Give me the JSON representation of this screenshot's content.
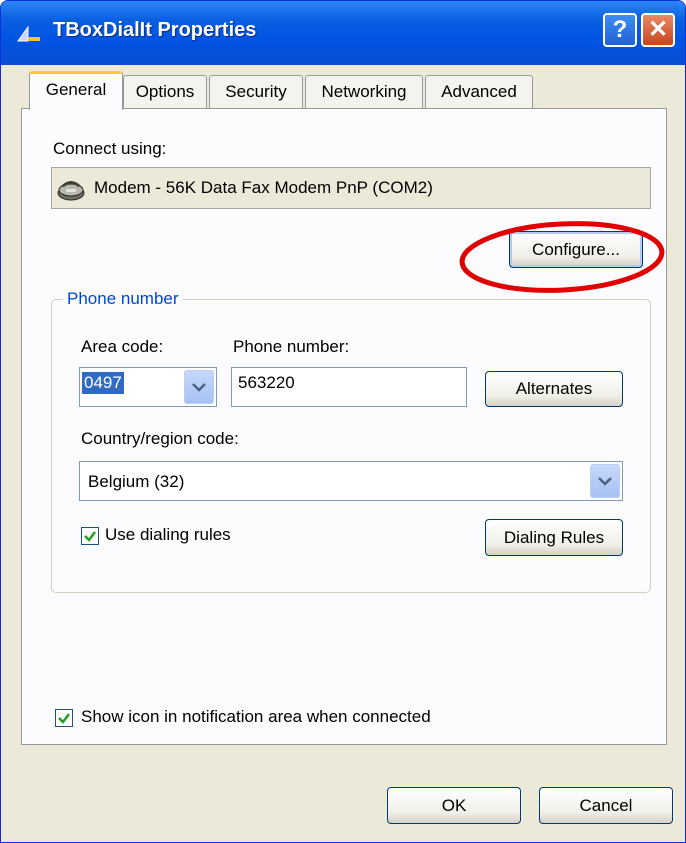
{
  "window": {
    "title": "TBoxDialIt Properties"
  },
  "titlebar": {
    "help_label": "?",
    "close_label": "✕"
  },
  "tabs": [
    {
      "label": "General"
    },
    {
      "label": "Options"
    },
    {
      "label": "Security"
    },
    {
      "label": "Networking"
    },
    {
      "label": "Advanced"
    }
  ],
  "general": {
    "connect_using_label": "Connect using:",
    "device_name": "Modem - 56K Data Fax Modem PnP (COM2)",
    "configure_label": "Configure...",
    "phone_group_title": "Phone number",
    "area_code_label": "Area code:",
    "area_code_value": "0497",
    "phone_number_label": "Phone number:",
    "phone_number_value": "563220",
    "alternates_label": "Alternates",
    "country_label": "Country/region code:",
    "country_value": "Belgium (32)",
    "use_dialing_rules_label": "Use dialing rules",
    "use_dialing_rules_checked": true,
    "dialing_rules_button": "Dialing Rules",
    "show_icon_label": "Show icon in notification area when connected",
    "show_icon_checked": true
  },
  "footer": {
    "ok_label": "OK",
    "cancel_label": "Cancel"
  },
  "colors": {
    "title_bar": "#0054e3",
    "highlight": "#316ac5",
    "group_title": "#0046d5",
    "annotation": "#e00000",
    "check": "#21a121"
  }
}
